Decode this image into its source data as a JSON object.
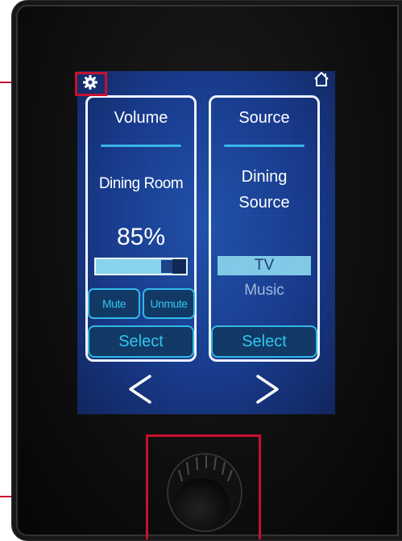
{
  "device": {
    "top_bar": {
      "settings_icon": "gear-icon",
      "home_icon": "home-icon"
    },
    "volume_panel": {
      "title": "Volume",
      "room": "Dining Room",
      "volume_percent": "85%",
      "volume_level": 0.85,
      "mute_label": "Mute",
      "unmute_label": "Unmute",
      "select_label": "Select"
    },
    "source_panel": {
      "title": "Source",
      "source_name_line1": "Dining",
      "source_name_line2": "Source",
      "options": [
        "TV",
        "Music"
      ],
      "selected_option": "TV",
      "select_label": "Select"
    },
    "navigation": {
      "prev_icon": "chevron-left-icon",
      "next_icon": "chevron-right-icon"
    },
    "colors": {
      "screen_blue": "#14378a",
      "accent_cyan": "#2cb6e8",
      "callout_red": "#c8102e",
      "bezel_black": "#0e0e0e"
    }
  }
}
